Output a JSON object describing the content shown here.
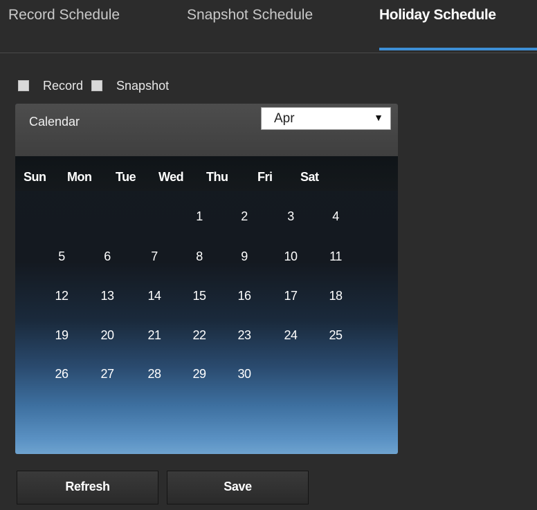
{
  "tabs": [
    {
      "label": "Record Schedule",
      "active": false
    },
    {
      "label": "Snapshot Schedule",
      "active": false
    },
    {
      "label": "Holiday Schedule",
      "active": true
    }
  ],
  "checkboxes": {
    "record": {
      "label": "Record",
      "checked": false
    },
    "snapshot": {
      "label": "Snapshot",
      "checked": false
    }
  },
  "calendar": {
    "title": "Calendar",
    "month": "Apr",
    "weekdays": [
      "Sun",
      "Mon",
      "Tue",
      "Wed",
      "Thu",
      "Fri",
      "Sat"
    ],
    "weeks": [
      [
        "",
        "",
        "",
        "1",
        "2",
        "3",
        "4"
      ],
      [
        "5",
        "6",
        "7",
        "8",
        "9",
        "10",
        "11"
      ],
      [
        "12",
        "13",
        "14",
        "15",
        "16",
        "17",
        "18"
      ],
      [
        "19",
        "20",
        "21",
        "22",
        "23",
        "24",
        "25"
      ],
      [
        "26",
        "27",
        "28",
        "29",
        "30",
        "",
        ""
      ]
    ]
  },
  "buttons": {
    "refresh": "Refresh",
    "save": "Save"
  },
  "colors": {
    "accent": "#3d8fd6",
    "background": "#2c2c2c"
  }
}
